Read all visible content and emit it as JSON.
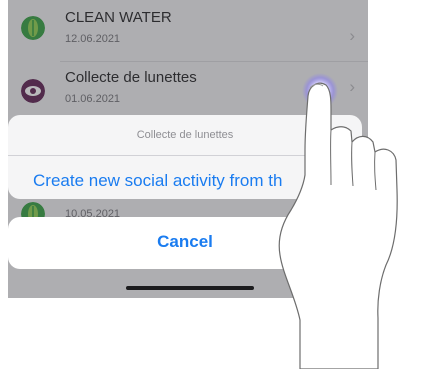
{
  "list": {
    "items": [
      {
        "title": "CLEAN WATER",
        "date": "12.06.2021",
        "icon": "leaf-icon",
        "color": "#2e9b3a"
      },
      {
        "title": "Collecte de lunettes",
        "date": "01.06.2021",
        "icon": "eye-icon",
        "color": "#5a1a4c"
      },
      {
        "title": "",
        "date": "10.05.2021",
        "icon": "leaf-icon",
        "color": "#2e9b3a"
      }
    ],
    "chevron": "›"
  },
  "action_sheet": {
    "title": "Collecte de lunettes",
    "action_label": "Create new social activity from th",
    "cancel_label": "Cancel"
  },
  "colors": {
    "accent": "#1a7cf0",
    "dim_overlay": "rgba(70,70,75,0.38)"
  }
}
